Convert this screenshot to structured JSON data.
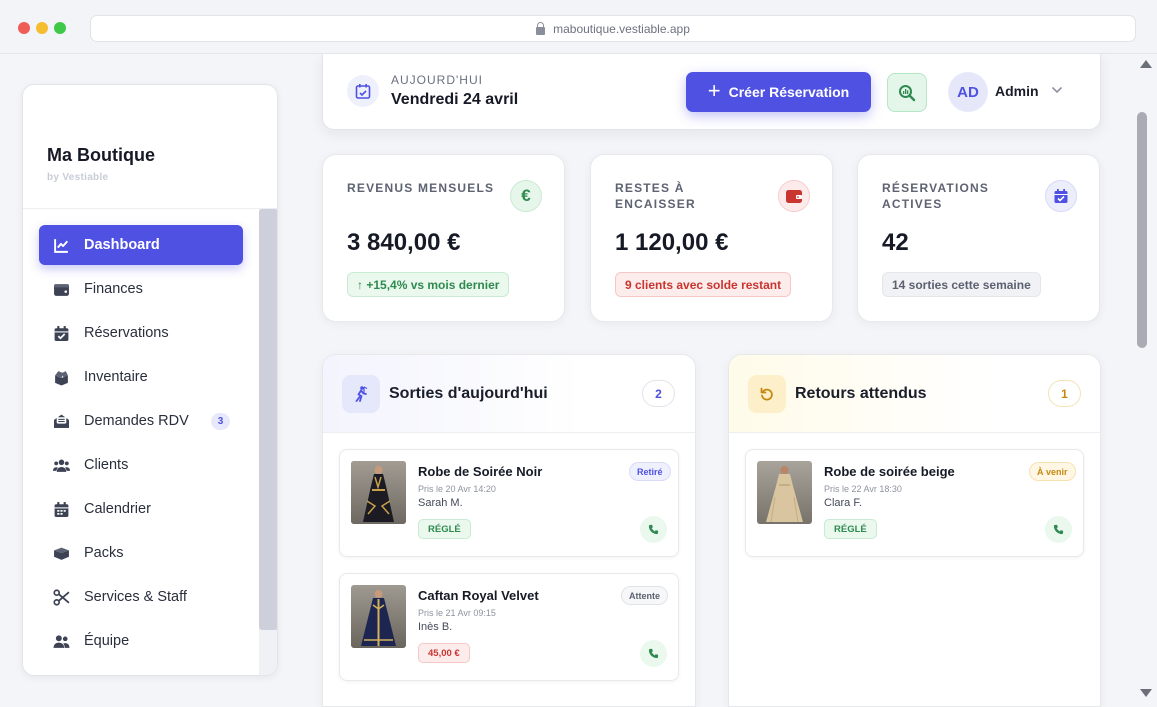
{
  "browser": {
    "url": "maboutique.vestiable.app"
  },
  "sidebar": {
    "brand_name": "Ma Boutique",
    "brand_sub": "by Vestiable",
    "items": [
      {
        "label": "Dashboard",
        "icon": "chart-line-icon",
        "active": true
      },
      {
        "label": "Finances",
        "icon": "wallet-icon"
      },
      {
        "label": "Réservations",
        "icon": "calendar-check-icon"
      },
      {
        "label": "Inventaire",
        "icon": "box-open-icon"
      },
      {
        "label": "Demandes RDV",
        "icon": "envelope-open-icon",
        "badge": "3"
      },
      {
        "label": "Clients",
        "icon": "users-icon"
      },
      {
        "label": "Calendrier",
        "icon": "calendar-icon"
      },
      {
        "label": "Packs",
        "icon": "boxes-icon"
      },
      {
        "label": "Services & Staff",
        "icon": "scissors-icon"
      },
      {
        "label": "Équipe",
        "icon": "user-group-icon"
      }
    ]
  },
  "topbar": {
    "today_label": "AUJOURD'HUI",
    "today_date": "Vendredi 24 avril",
    "create_label": "Créer Réservation",
    "avatar_initials": "AD",
    "admin_name": "Admin"
  },
  "stats": [
    {
      "label": "REVENUS MENSUELS",
      "value": "3 840,00 €",
      "pill": "↑  +15,4% vs mois dernier",
      "icon": "euro-icon"
    },
    {
      "label": "RESTES À ENCAISSER",
      "value": "1 120,00 €",
      "pill": "9 clients avec solde restant",
      "icon": "wallet-icon"
    },
    {
      "label": "RÉSERVATIONS ACTIVES",
      "value": "42",
      "pill": "14 sorties cette semaine",
      "icon": "calendar-check-icon"
    }
  ],
  "sorties": {
    "title": "Sorties d'aujourd'hui",
    "count": "2",
    "items": [
      {
        "name": "Robe de Soirée Noir",
        "meta": "Pris le 20 Avr 14:20",
        "client": "Sarah M.",
        "state": "Retiré",
        "pay": "RÉGLÉ"
      },
      {
        "name": "Caftan Royal Velvet",
        "meta": "Pris le 21 Avr 09:15",
        "client": "Inès B.",
        "state": "Attente",
        "pay": "45,00 €"
      }
    ]
  },
  "retours": {
    "title": "Retours attendus",
    "count": "1",
    "items": [
      {
        "name": "Robe de soirée beige",
        "meta": "Pris le 22 Avr 18:30",
        "client": "Clara F.",
        "state": "À venir",
        "pay": "RÉGLÉ"
      }
    ]
  },
  "colors": {
    "accent": "#4f51e3",
    "success": "#2f8a4f",
    "danger": "#c9352f",
    "warning": "#c78812"
  }
}
